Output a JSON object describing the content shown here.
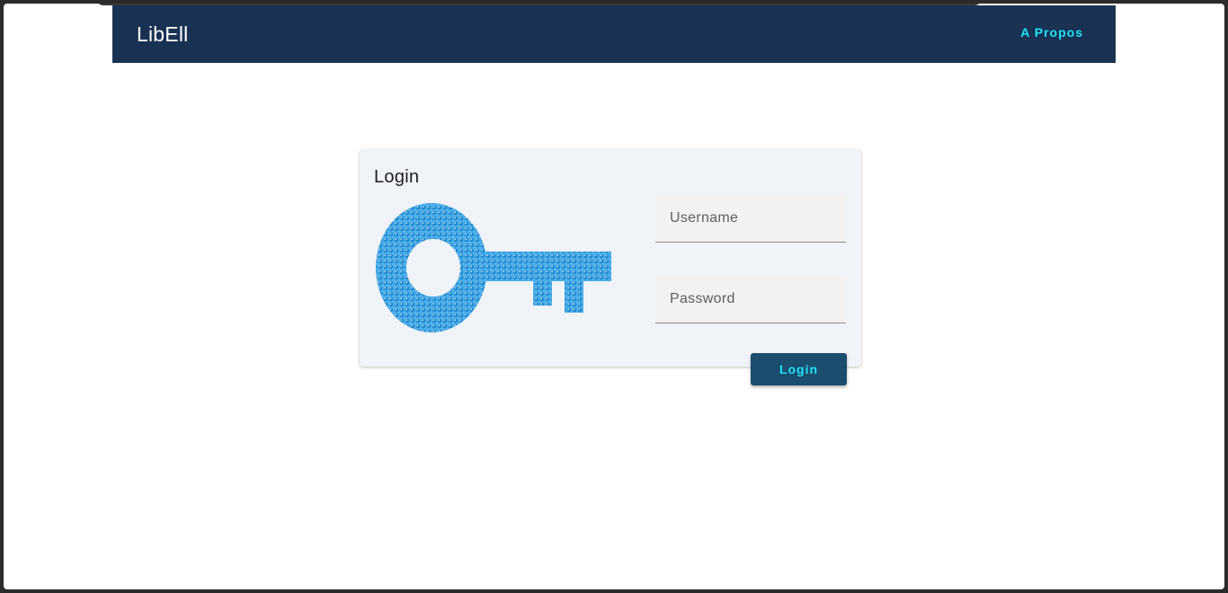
{
  "header": {
    "app_title": "LibEll",
    "about_link": "A Propos",
    "background_color": "#193153",
    "link_color": "#1ee3f5"
  },
  "login_card": {
    "title": "Login",
    "illustration": "key-icon",
    "username": {
      "placeholder": "Username",
      "value": ""
    },
    "password": {
      "placeholder": "Password",
      "value": ""
    },
    "submit_label": "Login",
    "button_color": "#1b4d6e",
    "key_color": "#3a9ee0"
  }
}
